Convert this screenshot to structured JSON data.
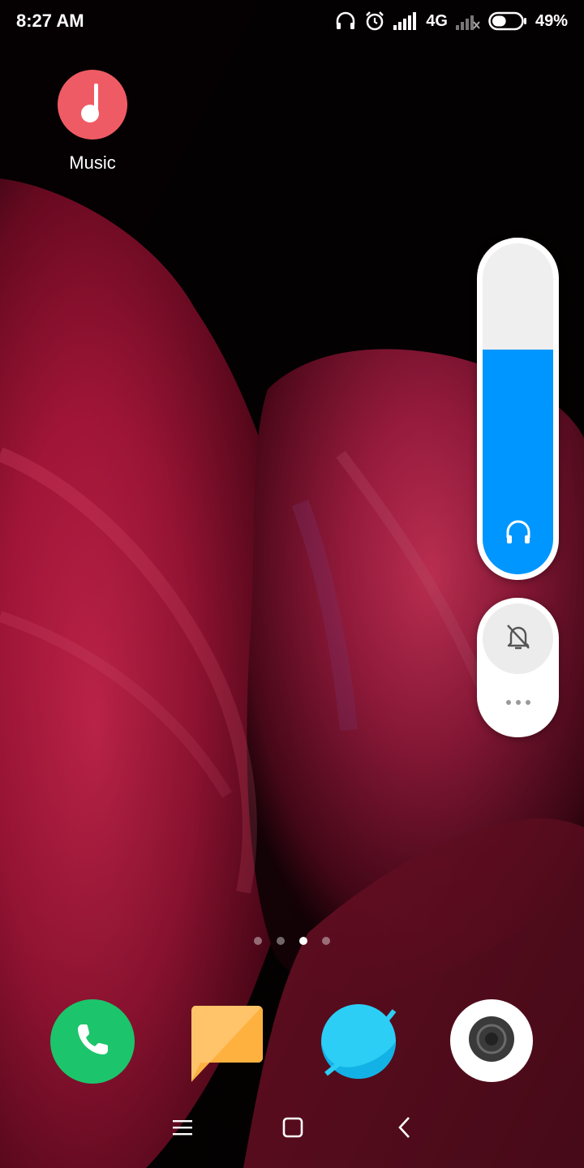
{
  "status_bar": {
    "time": "8:27 AM",
    "network": "4G",
    "battery": "49%",
    "battery_level": 0.49,
    "icons": [
      "headphones-icon",
      "alarm-icon",
      "signal-icon",
      "signal-no-sim-icon",
      "battery-icon"
    ]
  },
  "home": {
    "apps": [
      {
        "label": "Music",
        "icon": "music-note-icon",
        "color": "#ef5b64"
      }
    ]
  },
  "volume_panel": {
    "media_volume_level": 0.68,
    "output_icon": "headphones-icon",
    "fill_color": "#0096ff",
    "ringer_icon": "bell-muted-icon",
    "more_icon": "more-dots-icon"
  },
  "page_indicator": {
    "count": 4,
    "active_index": 2
  },
  "dock": {
    "apps": [
      {
        "icon": "phone-icon",
        "color": "#1cc56b"
      },
      {
        "icon": "messages-icon",
        "color": "#ffb347"
      },
      {
        "icon": "browser-icon",
        "color": "#1fb9ee"
      },
      {
        "icon": "camera-icon",
        "color": "#ffffff"
      }
    ]
  },
  "nav_bar": {
    "icons": [
      "menu-icon",
      "home-icon",
      "back-icon"
    ]
  }
}
